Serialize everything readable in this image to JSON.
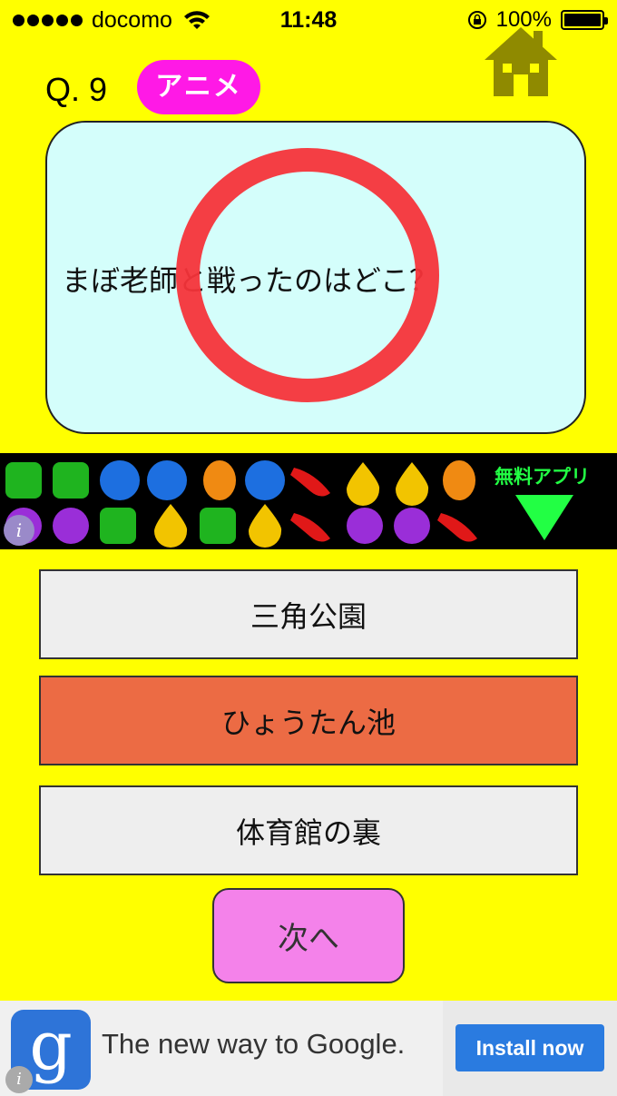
{
  "status_bar": {
    "carrier": "docomo",
    "time": "11:48",
    "battery": "100%",
    "battery_level": 1.0
  },
  "quiz": {
    "question_number": "Q. 9",
    "category": "アニメ",
    "question": "まぼ老師と戦ったのはどこ？",
    "choices": [
      "三角公園",
      "ひょうたん池",
      "体育館の裏"
    ],
    "selected_choice": "ひょうたん池",
    "next_label": "次へ",
    "result_mark": "correct-circle"
  },
  "ad_top": {
    "label": "無料アプリ",
    "info": "i"
  },
  "ad_bottom": {
    "logo_letter": "g",
    "headline": "The new way to Google.",
    "cta": "Install now",
    "info": "i"
  },
  "colors": {
    "background": "#ffff00",
    "category_badge": "#ff19e6",
    "question_card": "#d4fefb",
    "selected_choice": "#ec6b44",
    "choice": "#eeeeee",
    "next_button": "#f482ea",
    "correct_mark": "#f5343a"
  }
}
